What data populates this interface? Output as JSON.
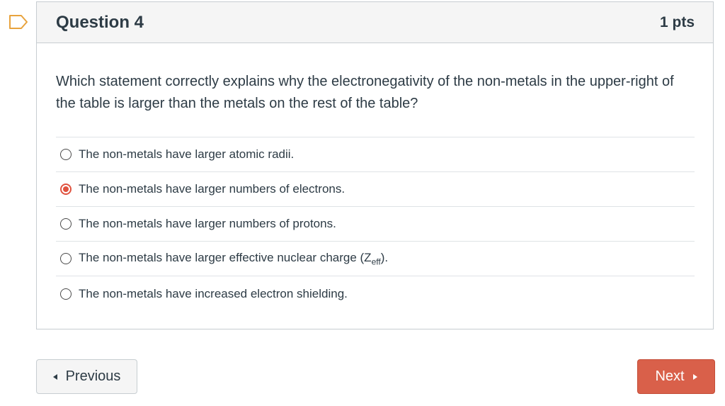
{
  "question": {
    "title": "Question 4",
    "points": "1 pts",
    "text": "Which statement correctly explains why the electronegativity of the non-metals in the upper-right of the table is larger than the metals on the rest of the table?",
    "answers": [
      {
        "label": "The non-metals have larger atomic radii.",
        "selected": false
      },
      {
        "label": "The non-metals have larger numbers of electrons.",
        "selected": true
      },
      {
        "label": "The non-metals have larger numbers of protons.",
        "selected": false
      },
      {
        "label_prefix": "The non-metals have larger effective nuclear charge (Z",
        "label_sub": "eff",
        "label_suffix": ").",
        "selected": false
      },
      {
        "label": "The non-metals have increased electron shielding.",
        "selected": false
      }
    ]
  },
  "nav": {
    "previous_label": "Previous",
    "next_label": "Next"
  },
  "colors": {
    "accent": "#d9604a",
    "selected_radio": "#e0523f",
    "flag_outline": "#e8a33d"
  },
  "icons": {
    "flag": "bookmark-flag-icon",
    "prev": "caret-left-icon",
    "next": "caret-right-icon"
  }
}
